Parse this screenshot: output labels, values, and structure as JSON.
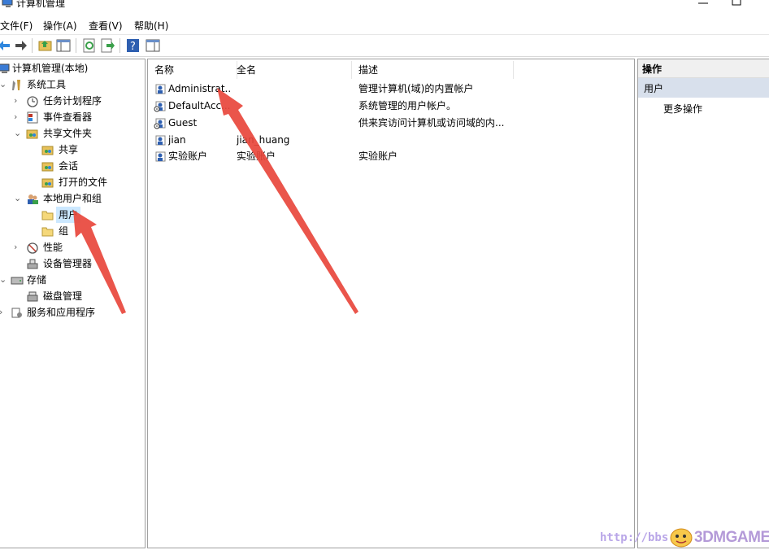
{
  "window": {
    "title": "计算机管理"
  },
  "menu": [
    "文件(F)",
    "操作(A)",
    "查看(V)",
    "帮助(H)"
  ],
  "tree": {
    "root": "计算机管理(本地)",
    "system_tools": "系统工具",
    "task_scheduler": "任务计划程序",
    "event_viewer": "事件查看器",
    "shared_folders": "共享文件夹",
    "shares": "共享",
    "sessions": "会话",
    "open_files": "打开的文件",
    "local_users_groups": "本地用户和组",
    "users": "用户",
    "groups": "组",
    "performance": "性能",
    "device_manager": "设备管理器",
    "storage": "存储",
    "disk_management": "磁盘管理",
    "services_apps": "服务和应用程序"
  },
  "list": {
    "columns": [
      "名称",
      "全名",
      "描述"
    ],
    "rows": [
      {
        "name": "Administrat...",
        "fullname": "",
        "desc": "管理计算机(域)的内置帐户"
      },
      {
        "name": "DefaultAcc...",
        "fullname": "",
        "desc": "系统管理的用户帐户。"
      },
      {
        "name": "Guest",
        "fullname": "",
        "desc": "供来宾访问计算机或访问域的内..."
      },
      {
        "name": "jian",
        "fullname": "jian_huang",
        "desc": ""
      },
      {
        "name": "实验账户",
        "fullname": "实验账户",
        "desc": "实验账户"
      }
    ]
  },
  "actions": {
    "header": "操作",
    "section": "用户",
    "more": "更多操作"
  },
  "watermark": {
    "url": "http://bbs.",
    "logo": "3DMGAME"
  },
  "colors": {
    "selection": "#cce8ff",
    "action_section": "#d8e0ec",
    "arrow": "#e8473c"
  }
}
